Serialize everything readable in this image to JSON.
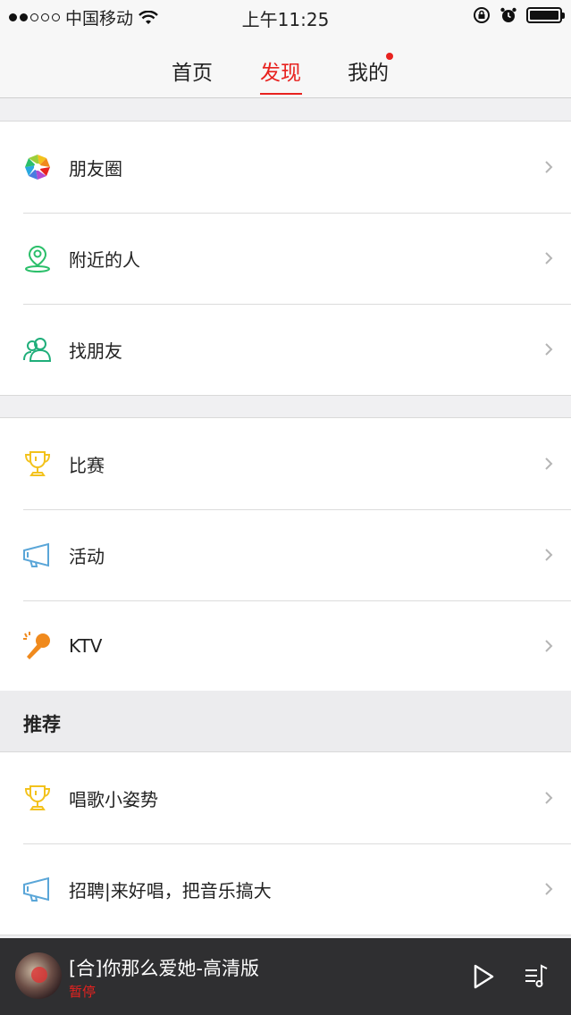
{
  "status_bar": {
    "carrier": "中国移动",
    "time": "上午11:25",
    "signal_icon": "signal-dots-icon",
    "wifi_icon": "wifi-icon",
    "lock_icon": "orientation-lock-icon",
    "alarm_icon": "alarm-icon",
    "battery_icon": "battery-icon"
  },
  "nav": {
    "tabs": [
      {
        "label": "首页"
      },
      {
        "label": "发现"
      },
      {
        "label": "我的"
      }
    ]
  },
  "group1": {
    "items": [
      {
        "label": "朋友圈",
        "icon": "aperture-icon"
      },
      {
        "label": "附近的人",
        "icon": "location-person-icon"
      },
      {
        "label": "找朋友",
        "icon": "friends-icon"
      }
    ]
  },
  "group2": {
    "items": [
      {
        "label": "比赛",
        "icon": "trophy-icon"
      },
      {
        "label": "活动",
        "icon": "megaphone-icon"
      },
      {
        "label": "KTV",
        "icon": "microphone-icon"
      }
    ]
  },
  "recommend": {
    "title": "推荐",
    "items": [
      {
        "label": "唱歌小姿势",
        "icon": "trophy-icon"
      },
      {
        "label": "招聘|来好唱，把音乐搞大",
        "icon": "megaphone-icon"
      }
    ]
  },
  "player": {
    "song": "[合]你那么爱她-高清版",
    "state": "暂停"
  },
  "colors": {
    "accent": "#e8221f",
    "green": "#2bbf6a",
    "yellow": "#f3c21c",
    "blue": "#5aa6d8",
    "orange": "#f08a1d"
  }
}
